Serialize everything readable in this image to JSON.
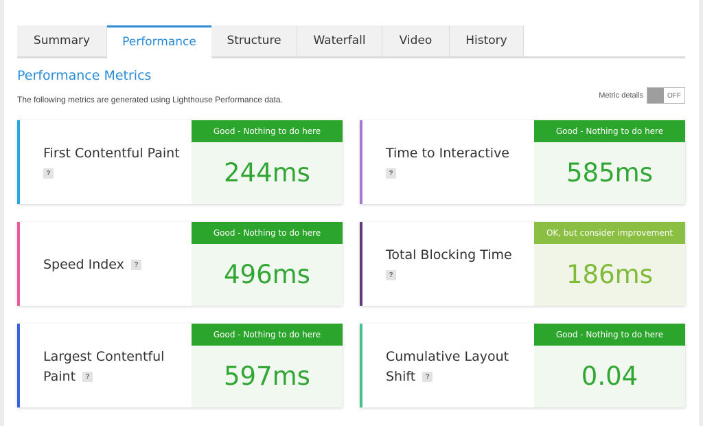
{
  "tabs": [
    {
      "label": "Summary"
    },
    {
      "label": "Performance"
    },
    {
      "label": "Structure"
    },
    {
      "label": "Waterfall"
    },
    {
      "label": "Video"
    },
    {
      "label": "History"
    }
  ],
  "section": {
    "title": "Performance Metrics",
    "description": "The following metrics are generated using Lighthouse Performance data."
  },
  "metric_details": {
    "label": "Metric details",
    "state": "OFF"
  },
  "help_glyph": "?",
  "metrics": [
    {
      "name": "First Contentful Paint",
      "grade": "Good - Nothing to do here",
      "value": "244ms",
      "bar_color": "#2aa5e4"
    },
    {
      "name": "Time to Interactive",
      "grade": "Good - Nothing to do here",
      "value": "585ms",
      "bar_color": "#a978d0"
    },
    {
      "name": "Speed Index",
      "grade": "Good - Nothing to do here",
      "value": "496ms",
      "bar_color": "#e95a9c"
    },
    {
      "name": "Total Blocking Time",
      "grade": "OK, but consider improvement",
      "value": "186ms",
      "bar_color": "#5e3c79"
    },
    {
      "name": "Largest Contentful Paint",
      "grade": "Good - Nothing to do here",
      "value": "597ms",
      "bar_color": "#3a62d8"
    },
    {
      "name": "Cumulative Layout Shift",
      "grade": "Good - Nothing to do here",
      "value": "0.04",
      "bar_color": "#45c18e"
    }
  ],
  "colors": {
    "accent": "#2a8bd7",
    "good": "#2ba52b",
    "ok": "#8bbf43"
  }
}
